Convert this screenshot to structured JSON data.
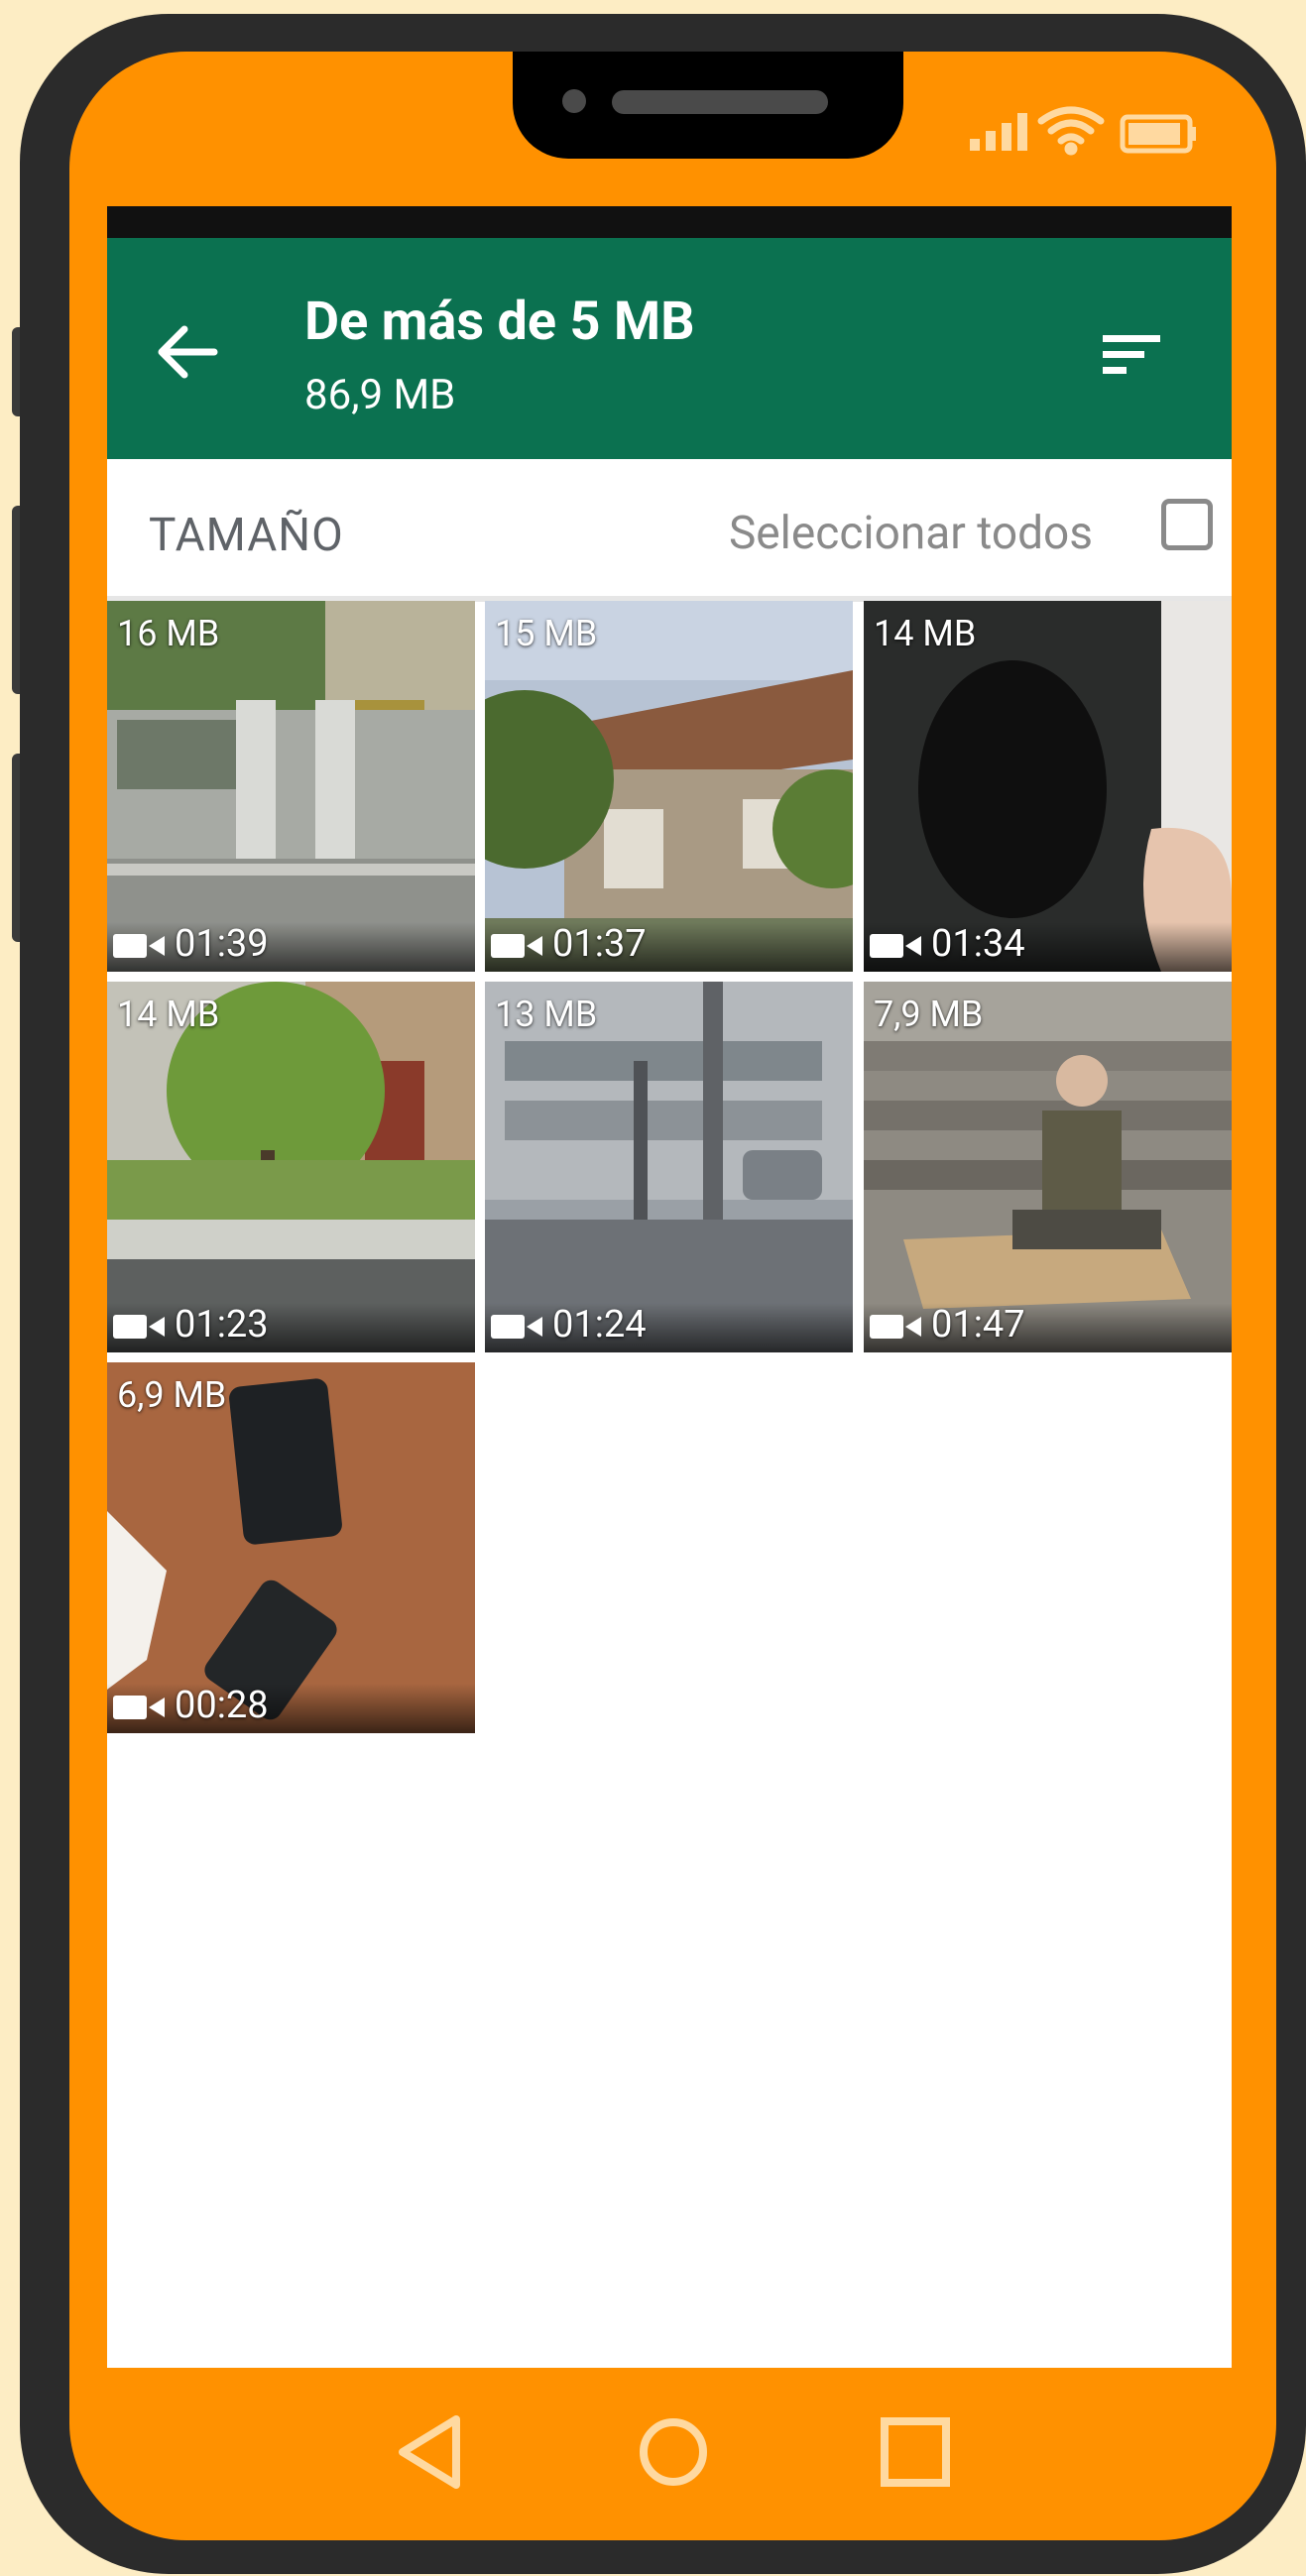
{
  "app_bar": {
    "title": "De más de 5 MB",
    "subtitle": "86,9 MB",
    "color": "#0b7150",
    "back_icon": "arrow-left-icon",
    "sort_icon": "sort-icon"
  },
  "filter_row": {
    "sort_label": "TAMAÑO",
    "select_all_label": "Seleccionar todos",
    "select_all_checked": false
  },
  "media_items": [
    {
      "size": "16 MB",
      "duration": "01:39",
      "type": "video",
      "scene": "house-gate"
    },
    {
      "size": "15 MB",
      "duration": "01:37",
      "type": "video",
      "scene": "old-house"
    },
    {
      "size": "14 MB",
      "duration": "01:34",
      "type": "video",
      "scene": "phone-hand"
    },
    {
      "size": "14 MB",
      "duration": "01:23",
      "type": "video",
      "scene": "tree-street"
    },
    {
      "size": "13 MB",
      "duration": "01:24",
      "type": "video",
      "scene": "street"
    },
    {
      "size": "7,9 MB",
      "duration": "01:47",
      "type": "video",
      "scene": "man-steps"
    },
    {
      "size": "6,9 MB",
      "duration": "00:28",
      "type": "video",
      "scene": "phones-table"
    }
  ],
  "device": {
    "frame_color": "#ff9100",
    "background_color": "#fdedc4",
    "status_icons": [
      "signal-icon",
      "wifi-icon",
      "battery-icon"
    ]
  },
  "nav_bar": {
    "icons": [
      "back-triangle-icon",
      "home-circle-icon",
      "recents-square-icon"
    ]
  }
}
